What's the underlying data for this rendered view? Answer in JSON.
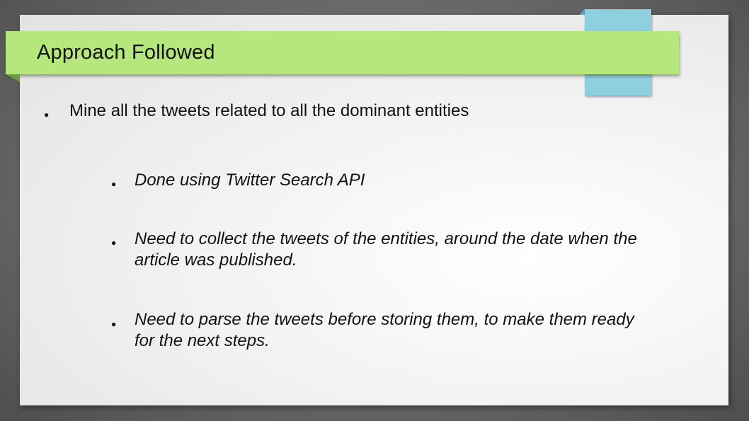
{
  "slide": {
    "title": "Approach Followed",
    "bullet_symbol": "●",
    "main_bullet": "Mine all the tweets related to all the dominant entities",
    "sub_bullets": [
      {
        "line1": "Done using Twitter Search API",
        "line2": ""
      },
      {
        "line1": "Need to collect the tweets of the entities, around the date when the",
        "line2": "article was published."
      },
      {
        "line1": "Need to parse the tweets before storing them, to make them ready",
        "line2": "for the next steps."
      }
    ]
  },
  "colors": {
    "title_bar": "#b5e77d",
    "accent_tab": "#8ecfe0",
    "text": "#111111"
  }
}
